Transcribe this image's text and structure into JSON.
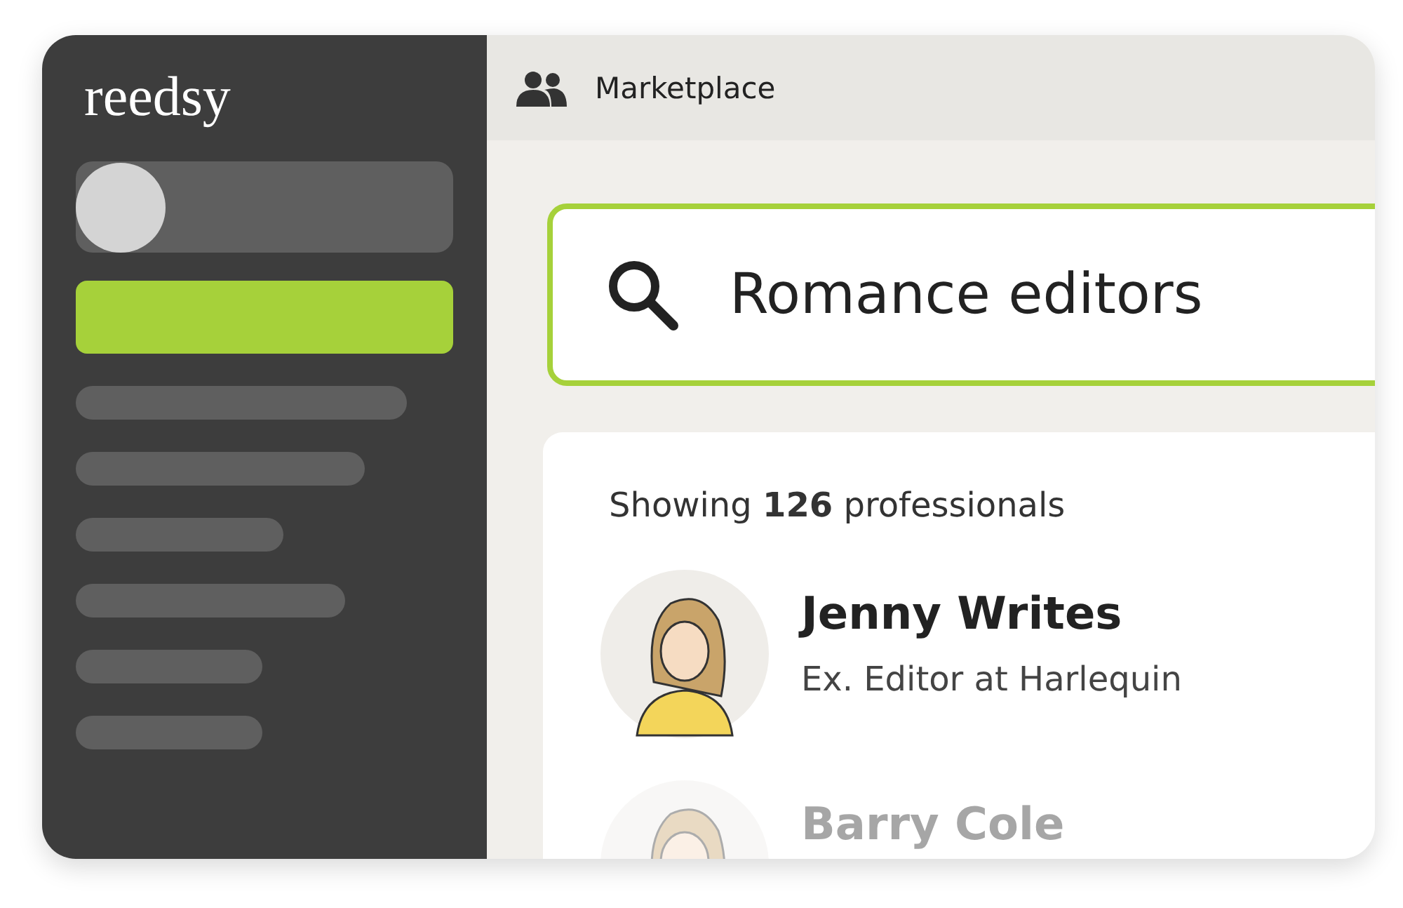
{
  "sidebar": {
    "logo": "reedsy"
  },
  "header": {
    "title": "Marketplace"
  },
  "search": {
    "value": "Romance editors"
  },
  "results": {
    "summary": "Showing **126** professionals",
    "professionals": [
      {
        "name": "Jenny Writes",
        "title": "Ex. Editor at Harlequin"
      },
      {
        "name": "Barry Cole"
      }
    ]
  }
}
